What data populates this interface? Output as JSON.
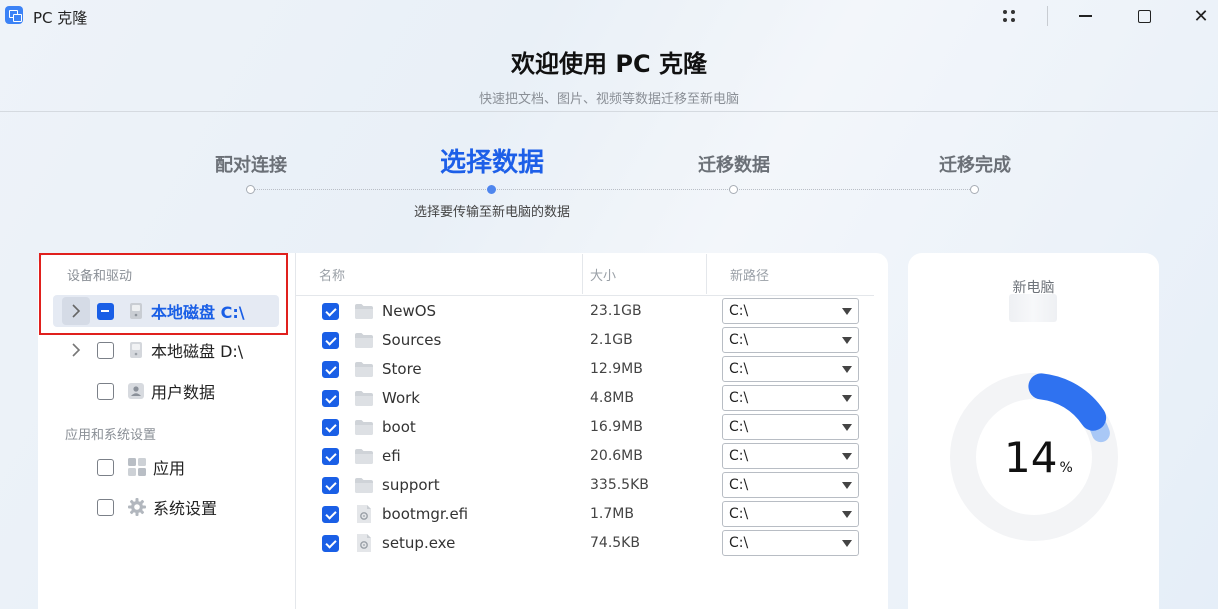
{
  "app": {
    "title": "PC 克隆",
    "window_controls": [
      "more",
      "minimize",
      "maximize",
      "close"
    ]
  },
  "header": {
    "title": "欢迎使用 PC 克隆",
    "subtitle": "快速把文档、图片、视频等数据迁移至新电脑"
  },
  "steps": {
    "items": [
      "配对连接",
      "选择数据",
      "迁移数据",
      "迁移完成"
    ],
    "active_index": 1,
    "active_description": "选择要传输至新电脑的数据"
  },
  "sidebar": {
    "section_devices": "设备和驱动",
    "section_apps": "应用和系统设置",
    "items": [
      {
        "label": "本地磁盘 C:\\",
        "state": "partial",
        "expandable": true,
        "selected": true,
        "icon": "drive-icon"
      },
      {
        "label": "本地磁盘 D:\\",
        "state": "unchecked",
        "expandable": true,
        "selected": false,
        "icon": "drive-icon"
      },
      {
        "label": "用户数据",
        "state": "unchecked",
        "expandable": false,
        "selected": false,
        "icon": "user-icon"
      },
      {
        "label": "应用",
        "state": "unchecked",
        "expandable": false,
        "selected": false,
        "icon": "apps-icon"
      },
      {
        "label": "系统设置",
        "state": "unchecked",
        "expandable": false,
        "selected": false,
        "icon": "gear-icon"
      }
    ]
  },
  "table": {
    "columns": [
      "名称",
      "大小",
      "新路径"
    ],
    "rows": [
      {
        "name": "NewOS",
        "size": "23.1GB",
        "path": "C:\\",
        "type": "folder",
        "checked": true
      },
      {
        "name": "Sources",
        "size": "2.1GB",
        "path": "C:\\",
        "type": "folder",
        "checked": true
      },
      {
        "name": "Store",
        "size": "12.9MB",
        "path": "C:\\",
        "type": "folder",
        "checked": true
      },
      {
        "name": "Work",
        "size": "4.8MB",
        "path": "C:\\",
        "type": "folder",
        "checked": true
      },
      {
        "name": "boot",
        "size": "16.9MB",
        "path": "C:\\",
        "type": "folder",
        "checked": true
      },
      {
        "name": "efi",
        "size": "20.6MB",
        "path": "C:\\",
        "type": "folder",
        "checked": true
      },
      {
        "name": "support",
        "size": "335.5KB",
        "path": "C:\\",
        "type": "folder",
        "checked": true
      },
      {
        "name": "bootmgr.efi",
        "size": "1.7MB",
        "path": "C:\\",
        "type": "file",
        "checked": true
      },
      {
        "name": "setup.exe",
        "size": "74.5KB",
        "path": "C:\\",
        "type": "file",
        "checked": true
      }
    ]
  },
  "new_pc": {
    "label": "新电脑",
    "usage_percent": 14,
    "percent_unit": "%"
  },
  "colors": {
    "accent": "#1a5fe6",
    "gauge_primary": "#2f72f0",
    "gauge_secondary": "#a9c8f6",
    "gauge_track": "#f3f4f6",
    "highlight_box": "#e0201d"
  }
}
